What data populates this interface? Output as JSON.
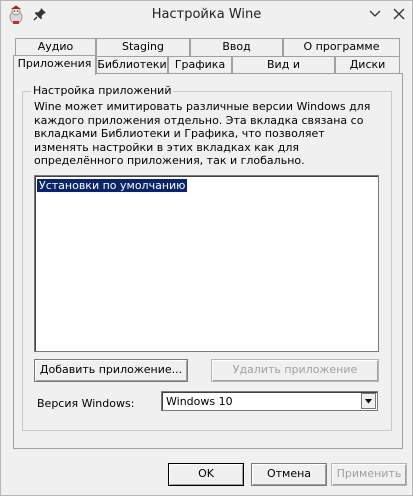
{
  "window": {
    "title": "Настройка Wine"
  },
  "tabs": {
    "row1": [
      "Аудио",
      "Staging",
      "Ввод",
      "О программе"
    ],
    "row2": [
      "Приложения",
      "Библиотеки",
      "Графика",
      "Вид и интеграция",
      "Диски"
    ],
    "active": "Приложения"
  },
  "group": {
    "label": "Настройка приложений",
    "description": "Wine может имитировать различные версии Windows для каждого приложения отдельно. Эта вкладка связана со вкладками Библиотеки и Графика, что позволяет изменять настройки в этих вкладках как для определённого приложения, так и глобально.",
    "list_items": [
      "Установки по умолчанию"
    ],
    "add_button": "Добавить приложение...",
    "remove_button": "Удалить приложение",
    "version_label": "Версия Windows:",
    "version_value": "Windows 10"
  },
  "footer": {
    "ok": "OK",
    "cancel": "Отмена",
    "apply": "Применить"
  },
  "icons": {
    "app": "wine-icon",
    "pin": "pin-icon",
    "minimize": "chevron-down-icon",
    "close": "close-icon",
    "dropdown": "triangle-down-icon"
  }
}
